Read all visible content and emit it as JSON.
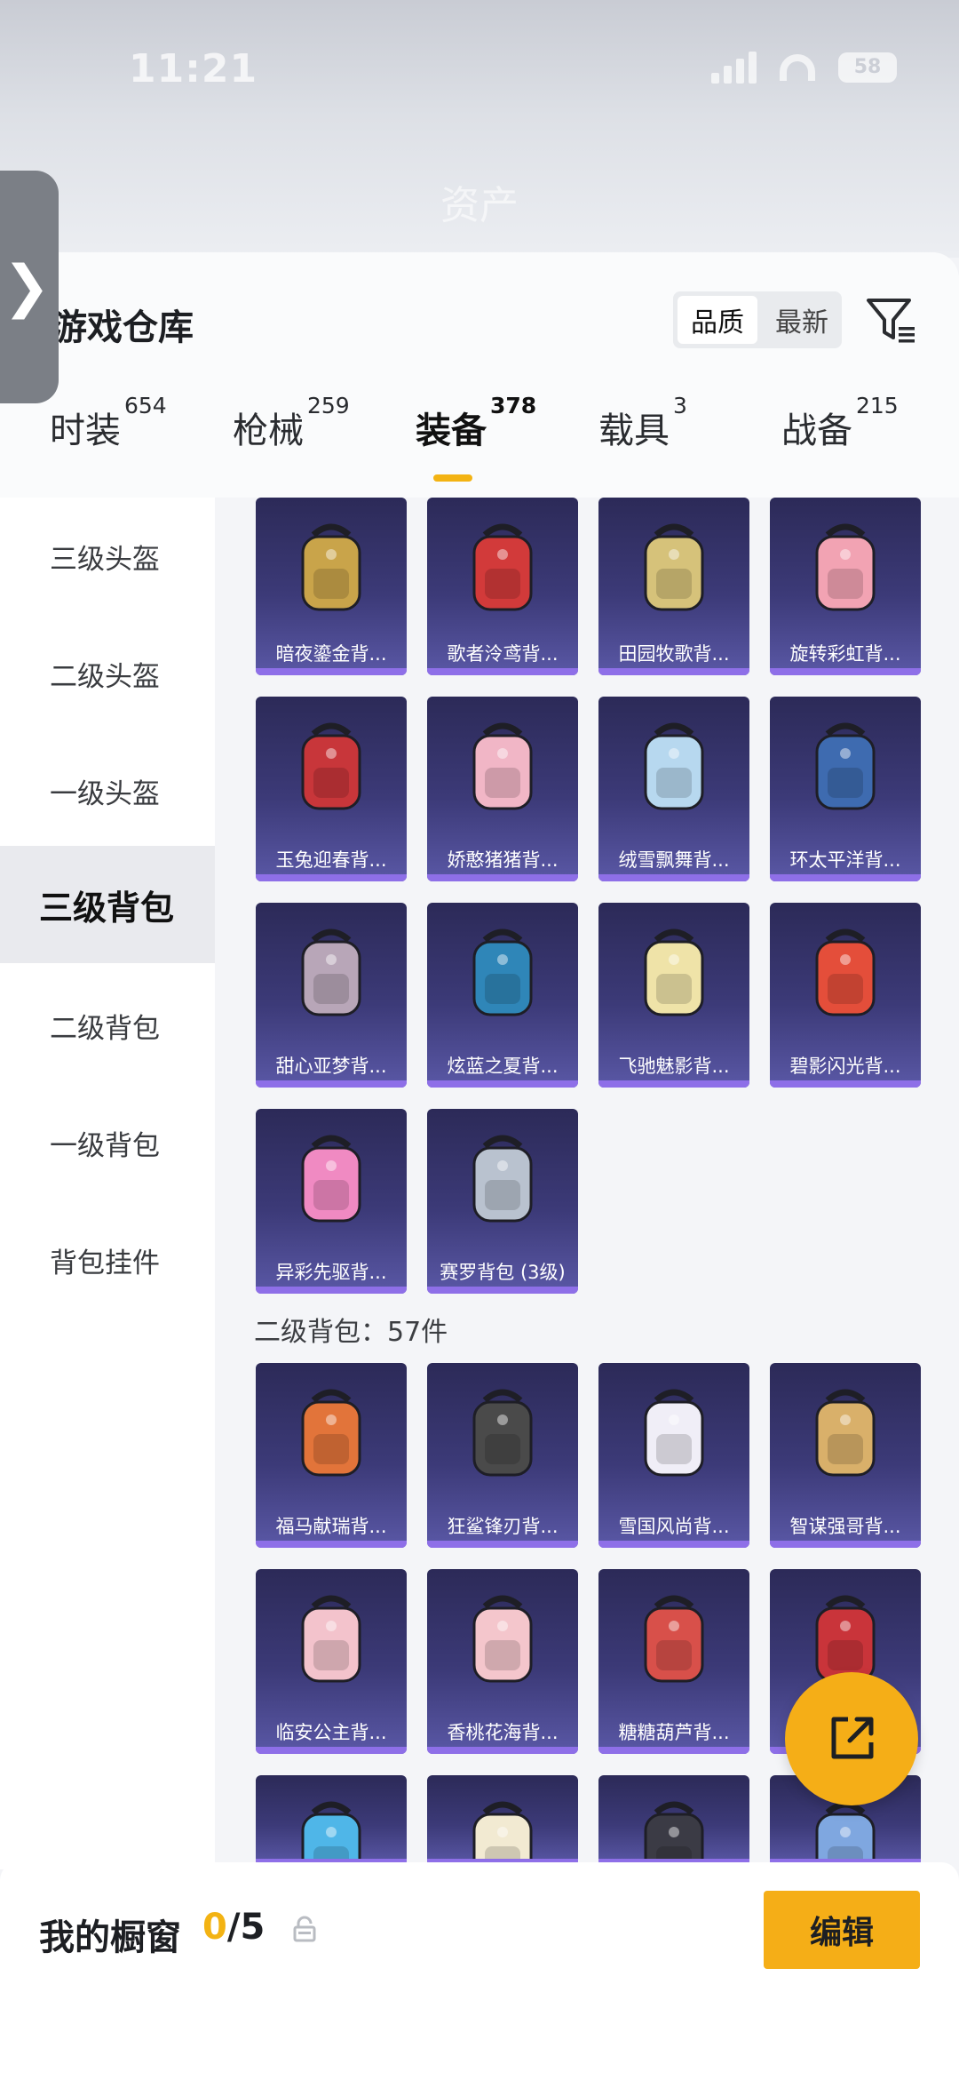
{
  "status_bar": {
    "time": "11:21",
    "battery": "58"
  },
  "header": {
    "blurred_title": "资产"
  },
  "warehouse": {
    "title": "游戏仓库",
    "sort_options": [
      "品质",
      "最新"
    ],
    "active_sort": "品质"
  },
  "category_tabs": [
    {
      "label": "时装",
      "count": "654"
    },
    {
      "label": "枪械",
      "count": "259"
    },
    {
      "label": "装备",
      "count": "378"
    },
    {
      "label": "载具",
      "count": "3"
    },
    {
      "label": "战备",
      "count": "215"
    }
  ],
  "active_category": "装备",
  "sidebar": {
    "items": [
      "三级头盔",
      "二级头盔",
      "一级头盔",
      "三级背包",
      "二级背包",
      "一级背包",
      "背包挂件"
    ],
    "active": "三级背包"
  },
  "level3_items": [
    {
      "label": "暗夜鎏金背...",
      "color": "#c9a44a"
    },
    {
      "label": "歌者泠鸢背...",
      "color": "#d23a3a"
    },
    {
      "label": "田园牧歌背...",
      "color": "#d6c27a"
    },
    {
      "label": "旋转彩虹背...",
      "color": "#f2a3b3"
    },
    {
      "label": "玉兔迎春背...",
      "color": "#c8363a"
    },
    {
      "label": "娇憨猪猪背...",
      "color": "#f1b6c6"
    },
    {
      "label": "绒雪飘舞背...",
      "color": "#b7d8ef"
    },
    {
      "label": "环太平洋背...",
      "color": "#3e6bb0"
    },
    {
      "label": "甜心亚梦背...",
      "color": "#b8a6b8"
    },
    {
      "label": "炫蓝之夏背...",
      "color": "#2f86b8"
    },
    {
      "label": "飞驰魅影背...",
      "color": "#efe3a8"
    },
    {
      "label": "碧影闪光背...",
      "color": "#e44e3a"
    },
    {
      "label": "异彩先驱背...",
      "color": "#f08ac2"
    },
    {
      "label": "赛罗背包 (3级)",
      "color": "#b9c2cf"
    }
  ],
  "level2_section": {
    "heading": "二级背包：57件"
  },
  "level2_items": [
    {
      "label": "福马献瑞背...",
      "color": "#e2743a"
    },
    {
      "label": "狂鲨锋刃背...",
      "color": "#4a4a4a"
    },
    {
      "label": "雪国风尚背...",
      "color": "#f0eef7"
    },
    {
      "label": "智谋强哥背...",
      "color": "#d9b06a"
    },
    {
      "label": "临安公主背...",
      "color": "#f3c3cc"
    },
    {
      "label": "香桃花海背...",
      "color": "#f4c6cc"
    },
    {
      "label": "糖糖葫芦背...",
      "color": "#d8504a"
    },
    {
      "label": "",
      "color": "#c9343a"
    },
    {
      "label": "",
      "color": "#4fb6e8"
    },
    {
      "label": "",
      "color": "#f2ead2"
    },
    {
      "label": "",
      "color": "#3b3b45"
    },
    {
      "label": "",
      "color": "#7fa7e0"
    }
  ],
  "showcase": {
    "title": "我的橱窗",
    "count_current": "0",
    "count_total": "/5",
    "edit_label": "编辑"
  }
}
